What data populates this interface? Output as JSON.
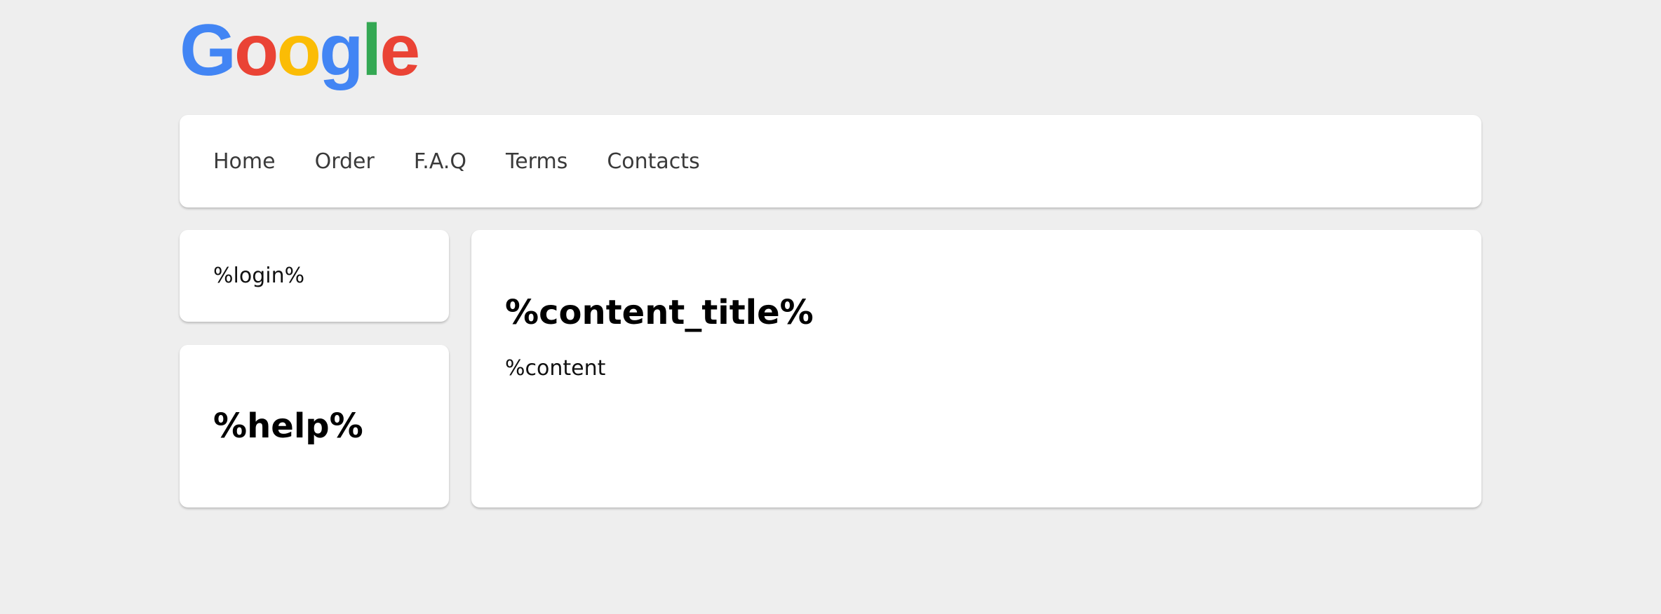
{
  "logo": {
    "text": "Google",
    "letters": [
      {
        "char": "G",
        "color": "#4285F4"
      },
      {
        "char": "o",
        "color": "#EA4335"
      },
      {
        "char": "o",
        "color": "#FBBC05"
      },
      {
        "char": "g",
        "color": "#4285F4"
      },
      {
        "char": "l",
        "color": "#34A853"
      },
      {
        "char": "e",
        "color": "#EA4335"
      }
    ]
  },
  "nav": {
    "items": [
      {
        "label": "Home"
      },
      {
        "label": "Order"
      },
      {
        "label": "F.A.Q"
      },
      {
        "label": "Terms"
      },
      {
        "label": "Contacts"
      }
    ]
  },
  "sidebar": {
    "login": "%login%",
    "help_title": "%help%"
  },
  "main": {
    "title": "%content_title%",
    "body": "%content"
  },
  "colors": {
    "background": "#eeeeee",
    "card": "#ffffff",
    "nav_text": "#3a3a3a"
  }
}
